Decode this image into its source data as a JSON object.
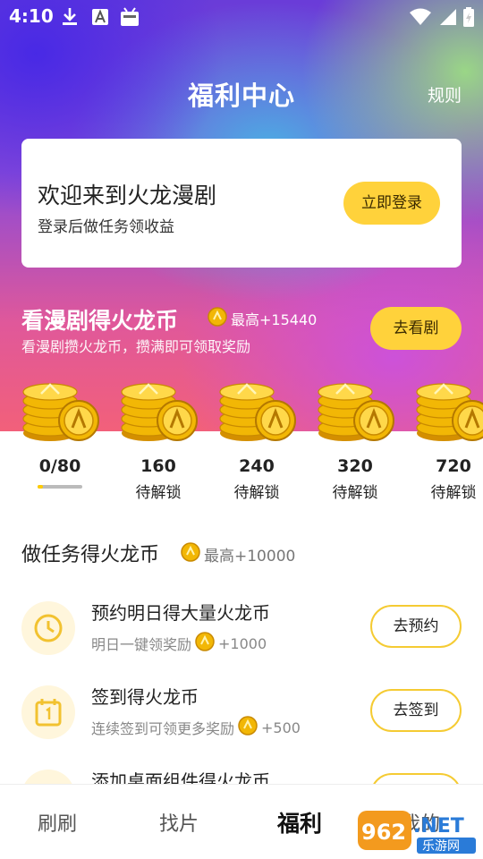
{
  "status_bar": {
    "time": "4:10"
  },
  "header": {
    "title": "福利中心",
    "rules_label": "规则"
  },
  "login_card": {
    "heading": "欢迎来到火龙漫剧",
    "subtext": "登录后做任务领收益",
    "button_label": "立即登录"
  },
  "watch_section": {
    "title": "看漫剧得火龙币",
    "max_label": "最高+15440",
    "subtitle": "看漫剧攒火龙币，攒满即可领取奖励",
    "button_label": "去看剧",
    "milestones": [
      {
        "value": "0/80",
        "status": ""
      },
      {
        "value": "160",
        "status": "待解锁"
      },
      {
        "value": "240",
        "status": "待解锁"
      },
      {
        "value": "320",
        "status": "待解锁"
      },
      {
        "value": "720",
        "status": "待解锁"
      }
    ],
    "progress_fraction": 0.0
  },
  "task_section": {
    "title": "做任务得火龙币",
    "max_label": "最高+10000",
    "tasks": [
      {
        "title": "预约明日得大量火龙币",
        "desc": "明日一键领奖励",
        "reward": "+1000",
        "button_label": "去预约",
        "icon": "clock-icon"
      },
      {
        "title": "签到得火龙币",
        "desc": "连续签到可领更多奖励",
        "reward": "+500",
        "button_label": "去签到",
        "icon": "calendar-icon"
      },
      {
        "title": "添加桌面组件得火龙币",
        "desc": "",
        "reward": "",
        "button_label": "",
        "icon": "widget-icon"
      }
    ]
  },
  "tabbar": {
    "tabs": [
      "刷刷",
      "找片",
      "福利",
      "我的"
    ],
    "active": "福利"
  },
  "watermark": {
    "text": "962.NET",
    "subtext": "乐游网"
  },
  "colors": {
    "accent_yellow": "#ffd23b",
    "coin_gold": "#f2b705"
  }
}
